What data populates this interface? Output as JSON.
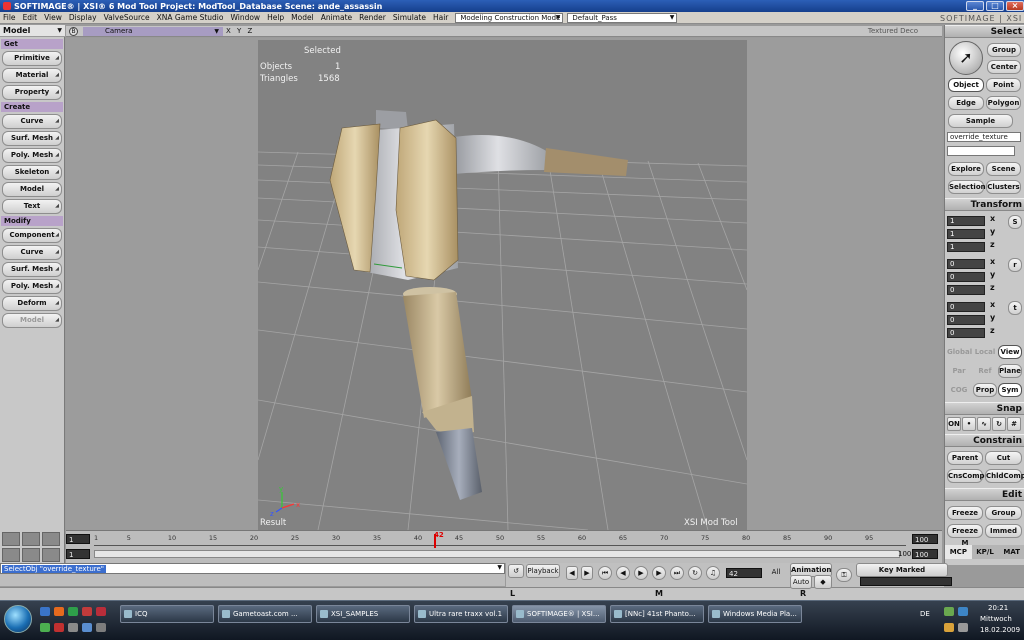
{
  "window": {
    "title": "SOFTIMAGE® | XSI® 6 Mod Tool Project: ModTool_Database    Scene: ande_assassin",
    "brand": "SOFTIMAGE | XSI"
  },
  "menu": {
    "items": [
      "File",
      "Edit",
      "View",
      "Display",
      "ValveSource",
      "XNA Game Studio",
      "Window",
      "Help",
      "Model",
      "Animate",
      "Render",
      "Simulate",
      "Hair"
    ],
    "mode": "Modeling Construction Mode",
    "pass": "Default_Pass"
  },
  "left_panel": {
    "title": "Model",
    "sections": [
      {
        "label": "Get",
        "buttons": [
          "Primitive",
          "Material",
          "Property"
        ]
      },
      {
        "label": "Create",
        "buttons": [
          "Curve",
          "Surf. Mesh",
          "Poly. Mesh",
          "Skeleton",
          "Model",
          "Text"
        ]
      },
      {
        "label": "Modify",
        "buttons": [
          "Component",
          "Curve",
          "Surf. Mesh",
          "Poly. Mesh",
          "Deform",
          "Model"
        ]
      }
    ]
  },
  "viewport": {
    "tag": "B",
    "camera": "Camera",
    "axes_toggle": "X Y Z",
    "shading": "Textured Deco",
    "selected_label": "Selected",
    "objects_label": "Objects",
    "objects_value": "1",
    "triangles_label": "Triangles",
    "triangles_value": "1568",
    "result_label": "Result",
    "watermark": "XSI Mod Tool"
  },
  "right_panel": {
    "select": {
      "title": "Select",
      "group": "Group",
      "center": "Center",
      "object": "Object",
      "point": "Point",
      "edge": "Edge",
      "polygon": "Polygon",
      "sample": "Sample",
      "filter": "override_texture",
      "explore": "Explore",
      "scene": "Scene",
      "selection": "Selection",
      "clusters": "Clusters"
    },
    "transform": {
      "title": "Transform",
      "scale": [
        "1",
        "1",
        "1"
      ],
      "rotate": [
        "0",
        "0",
        "0"
      ],
      "translate": [
        "0",
        "0",
        "0"
      ],
      "s": "S",
      "r": "r",
      "t": "t",
      "x": "x",
      "y": "y",
      "z": "z",
      "global": "Global",
      "local": "Local",
      "view": "View",
      "par": "Par",
      "ref": "Ref",
      "plane": "Plane",
      "cog": "COG",
      "prop": "Prop",
      "sym": "Sym"
    },
    "snap": {
      "title": "Snap",
      "on": "ON"
    },
    "constrain": {
      "title": "Constrain",
      "parent": "Parent",
      "cut": "Cut",
      "cnscomp": "CnsComp",
      "chldcomp": "ChldComp"
    },
    "edit": {
      "title": "Edit",
      "freeze": "Freeze",
      "group": "Group",
      "freeze_m": "Freeze M",
      "immed": "Immed"
    },
    "tabs": [
      "MCP",
      "KP/L",
      "MAT"
    ]
  },
  "timeline": {
    "start": "1",
    "start2": "1",
    "end": "100",
    "end2": "100",
    "end3": "100",
    "current": "42",
    "ticks": [
      "1",
      "5",
      "10",
      "15",
      "20",
      "25",
      "30",
      "35",
      "40",
      "45",
      "50",
      "55",
      "60",
      "65",
      "70",
      "75",
      "80",
      "85",
      "90",
      "95"
    ]
  },
  "playback": {
    "command": "SelectObj \"override_texture\"",
    "playback": "Playback",
    "frame": "42",
    "all": "All",
    "animation": "Animation",
    "auto": "Auto",
    "key_marked": "Key Marked Parameters",
    "markers": [
      "L",
      "M",
      "R"
    ]
  },
  "taskbar": {
    "tasks": [
      "ICQ",
      "Gametoast.com ...",
      "XSI_SAMPLES",
      "Ultra rare traxx vol.1",
      "SOFTIMAGE® | XSI...",
      "[NNc] 41st Phanto...",
      "Windows Media Pla..."
    ],
    "lang": "DE",
    "time": "20:21",
    "day": "Mittwoch",
    "date": "18.02.2009"
  },
  "colors": {
    "title_bar": "#1f4ea0",
    "section": "#b8a2c9",
    "camera_bar": "#a79cc2",
    "viewport": "#828282",
    "cmd_selection": "#3b6ecf"
  }
}
